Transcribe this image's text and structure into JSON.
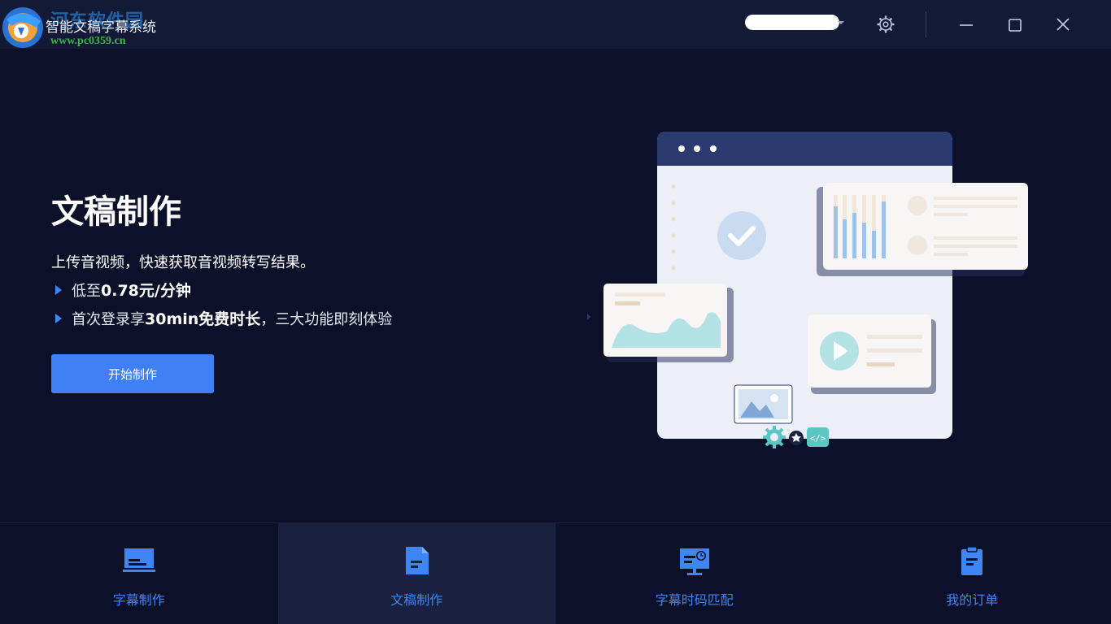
{
  "titlebar": {
    "watermark_title": "河东软件园",
    "watermark_url": "www.pc0359.cn",
    "app_title": "智能文稿字幕系统"
  },
  "hero": {
    "title": "文稿制作",
    "description": "上传音视频，快速获取音视频转写结果。",
    "bullet1_prefix": "低至",
    "bullet1_bold": "0.78元/分钟",
    "bullet2_prefix": "首次登录享",
    "bullet2_bold": "30min免费时长",
    "bullet2_suffix": "，三大功能即刻体验",
    "start_button": "开始制作"
  },
  "bottom_nav": {
    "items": [
      {
        "label": "字幕制作",
        "icon": "monitor-subtitle-icon"
      },
      {
        "label": "文稿制作",
        "icon": "document-icon",
        "active": true
      },
      {
        "label": "字幕时码匹配",
        "icon": "monitor-clock-icon"
      },
      {
        "label": "我的订单",
        "icon": "clipboard-icon"
      }
    ]
  },
  "colors": {
    "background": "#0c1029",
    "titlebar": "#131a36",
    "accent": "#3f80f4",
    "nav_active": "#1a2040"
  }
}
